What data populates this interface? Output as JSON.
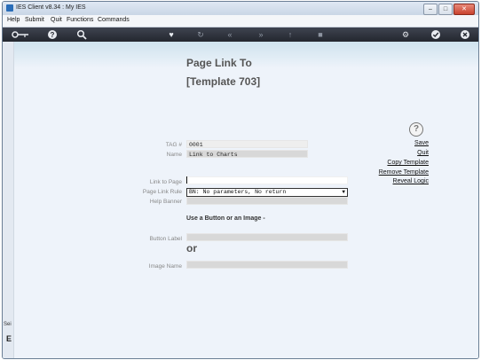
{
  "window": {
    "title": "IES Client v8.34 : My IES"
  },
  "menu": [
    "Help",
    "Submit",
    "Quit",
    "Functions",
    "Commands"
  ],
  "toolbar": {
    "icons": [
      "key-icon",
      "help-icon",
      "search-icon",
      "heart-icon",
      "refresh-icon",
      "back-icon",
      "forward-icon",
      "up-icon",
      "stop-icon",
      "gear-icon",
      "check-icon",
      "close-icon"
    ]
  },
  "page": {
    "title": "Page Link To",
    "subtitle": "[Template 703]"
  },
  "form": {
    "tag_label": "TAG #",
    "tag_value": "0001",
    "name_label": "Name",
    "name_value": "Link to Charts",
    "link_label": "Link to Page",
    "link_value": "",
    "rule_label": "Page Link Rule",
    "rule_value": "BN: No parameters, No return",
    "banner_label": "Help Banner",
    "banner_value": "",
    "section_text": "Use a Button or an Image -",
    "button_label_label": "Button Label",
    "button_label_value": "",
    "or_text": "or",
    "image_label": "Image Name",
    "image_value": ""
  },
  "actions": {
    "save": "Save",
    "quit": "Quit",
    "copy": "Copy Template",
    "remove": "Remove Template",
    "reveal": "Reveal Logic"
  },
  "sidebar": {
    "label": "Sei",
    "letter": "E"
  },
  "colors": {
    "toolbar_bg": "#2b2f37",
    "content_bg": "#eef3fa",
    "title_text": "#555555"
  }
}
